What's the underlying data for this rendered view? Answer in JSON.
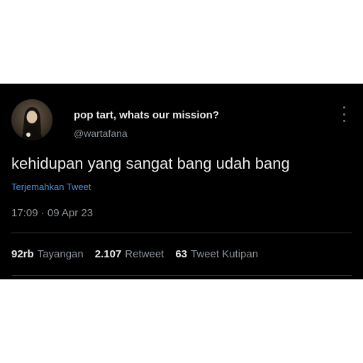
{
  "tweet": {
    "display_name": "pop tart, whats our mission?",
    "handle": "@wartafana",
    "text": "kehidupan yang sangat bang udah bang",
    "translate_label": "Terjemahkan Tweet",
    "timestamp": "17:09 · 09 Apr 23",
    "more_icon": "more-vertical-icon"
  },
  "stats": [
    {
      "value": "92rb",
      "label": "Tayangan"
    },
    {
      "value": "2.107",
      "label": "Retweet"
    },
    {
      "value": "63",
      "label": "Tweet Kutipan"
    }
  ],
  "colors": {
    "background": "#000000",
    "primary_text": "#e7e9ea",
    "secondary_text": "#8b9299",
    "link": "#4a90d9",
    "divider": "#2f3336"
  }
}
